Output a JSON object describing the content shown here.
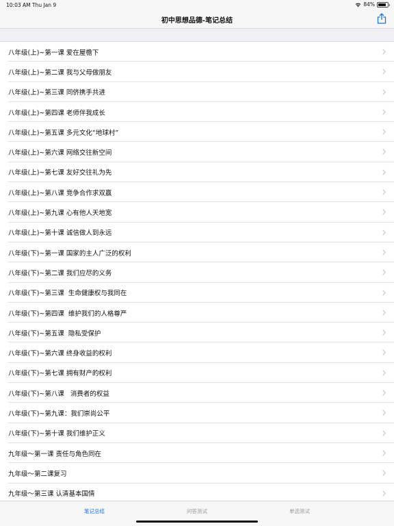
{
  "status_bar": {
    "time": "10:03 AM",
    "date": "Thu Jan 9",
    "battery": "84%",
    "battery_level": 0.84
  },
  "nav": {
    "title": "初中思想品德-笔记总结",
    "share_icon": "share-icon"
  },
  "list": {
    "items": [
      "八年级(上)~第一课 爱在屋檐下",
      "八年级(上)~第二课 我与父母做朋友",
      "八年级(上)~第三课 同侪携手共进",
      "八年级(上)~第四课 老师伴我成长",
      "八年级(上)~第五课 多元文化“地球村”",
      "八年级(上)~第六课 网络交往新空间",
      "八年级(上)~第七课 友好交往礼为先",
      "八年级(上)~第八课 竞争合作求双赢",
      "八年级(上)~第九课 心有他人天地宽",
      "八年级(上)~第十课 诚信做人到永远",
      "八年级(下)~第一课 国家的主人广泛的权利",
      "八年级(下)~第二课 我们应尽的义务",
      "八年级(下)~第三课  生命健康权与我同在",
      "八年级(下)~第四课  维护我们的人格尊严",
      "八年级(下)~第五课  隐私受保护",
      "八年级(下)~第六课 终身收益的权利",
      "八年级(下)~第七课 拥有财产的权利",
      "八年级(下)~第八课   消费者的权益",
      "八年级(下)~第九课：我们崇尚公平",
      "八年级(下)~第十课 我们维护正义",
      "九年级～第一课 责任与角色同在",
      "九年级～第二课复习",
      "九年级～第三课 认清基本国情"
    ]
  },
  "tabs": [
    {
      "label": "笔记总结",
      "active": true
    },
    {
      "label": "问答测试",
      "active": false
    },
    {
      "label": "单选测试",
      "active": false
    }
  ],
  "colors": {
    "accent": "#1a73e8",
    "inactive": "#9a9a9a",
    "chevron": "#c4c4c7"
  }
}
